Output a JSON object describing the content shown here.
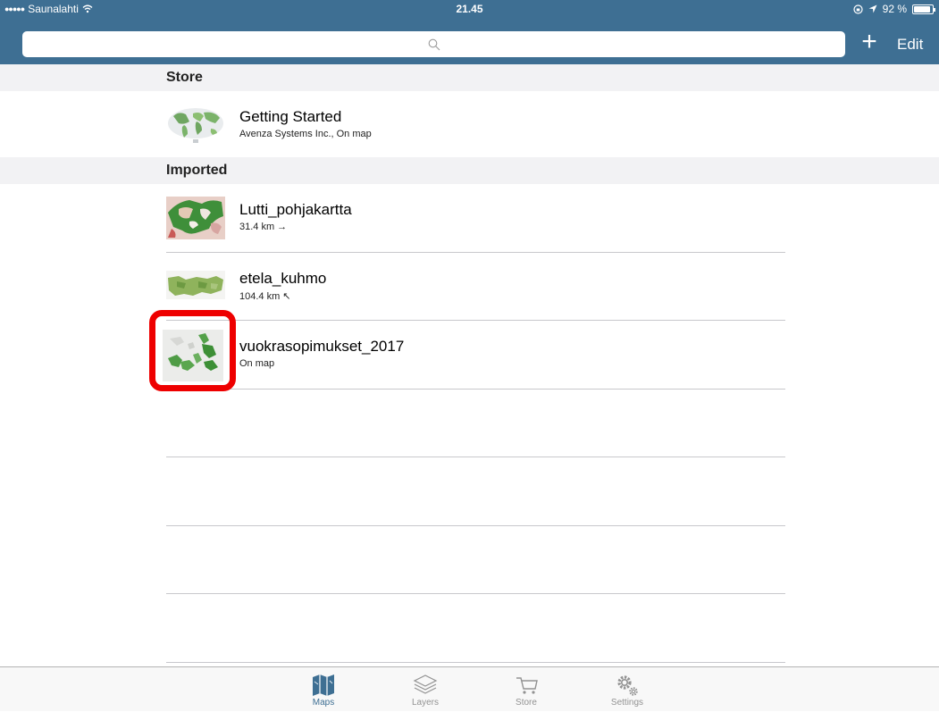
{
  "status": {
    "carrier": "Saunalahti",
    "time": "21.45",
    "battery": "92 %",
    "battery_level": 0.92
  },
  "nav": {
    "search_placeholder": "",
    "add_label": "+",
    "edit_label": "Edit"
  },
  "sections": {
    "store": {
      "header": "Store",
      "items": [
        {
          "title": "Getting Started",
          "subtitle": "Avenza Systems Inc., On map"
        }
      ]
    },
    "imported": {
      "header": "Imported",
      "items": [
        {
          "title": "Lutti_pohjakartta",
          "subtitle": "31.4 km →"
        },
        {
          "title": "etela_kuhmo",
          "subtitle": "104.4 km ↖"
        },
        {
          "title": "vuokrasopimukset_2017",
          "subtitle": "On map"
        }
      ]
    }
  },
  "tabs": [
    {
      "label": "Maps",
      "icon": "map-icon",
      "active": true
    },
    {
      "label": "Layers",
      "icon": "layers-icon",
      "active": false
    },
    {
      "label": "Store",
      "icon": "cart-icon",
      "active": false
    },
    {
      "label": "Settings",
      "icon": "gear-icon",
      "active": false
    }
  ],
  "colors": {
    "nav_bar": "#3e6f93",
    "active_tab": "#3e6f93",
    "inactive_tab": "#929292",
    "highlight": "#ee0000"
  }
}
